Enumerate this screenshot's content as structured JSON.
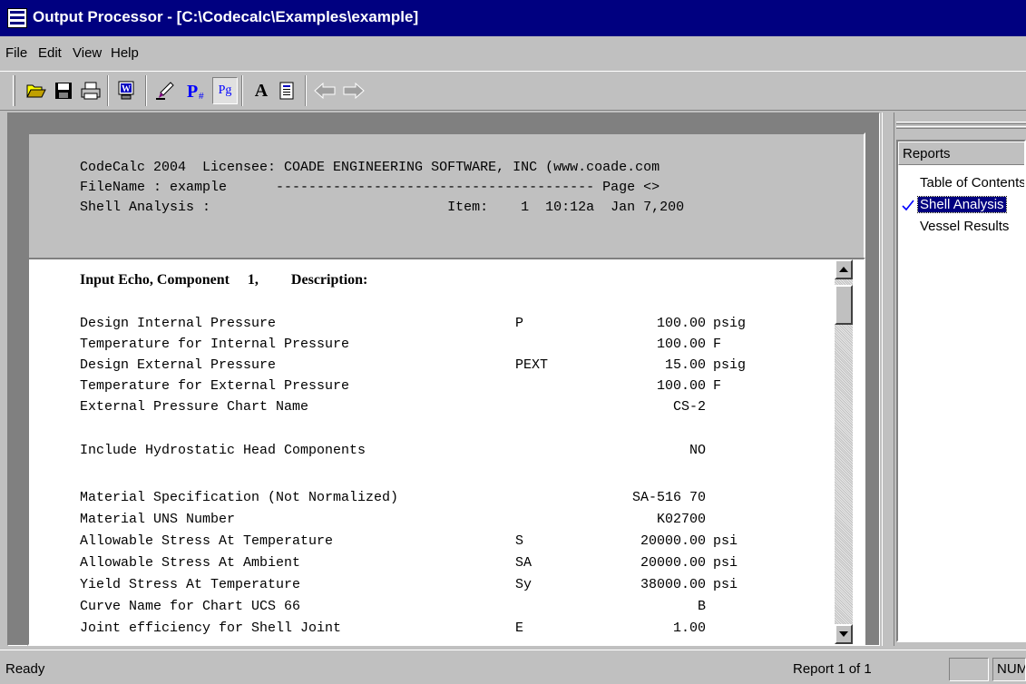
{
  "window": {
    "title": "Output Processor - [C:\\Codecalc\\Examples\\example]"
  },
  "menu": {
    "items": [
      "File",
      "Edit",
      "View",
      "Help"
    ]
  },
  "toolbar": {
    "buttons": [
      "open-icon",
      "save-icon",
      "print-icon",
      "word-export-icon",
      "highlighter-icon",
      "page-number-icon",
      "page-icon",
      "font-icon",
      "document-icon",
      "back-arrow-icon",
      "forward-arrow-icon"
    ],
    "pg_label": "Pg",
    "font_label": "A"
  },
  "report_header": {
    "lines": [
      "CodeCalc 2004  Licensee: COADE ENGINEERING SOFTWARE, INC (www.coade.com",
      "FileName : example      --------------------------------------- Page <>",
      "Shell Analysis :                             Item:    1  10:12a  Jan 7,200"
    ]
  },
  "report": {
    "echo_heading": "Input Echo, Component     1,         Description:",
    "rows": [
      {
        "label": "Design Internal Pressure",
        "sym": "P",
        "value": "100.00",
        "unit": "psig"
      },
      {
        "label": "Temperature for Internal Pressure",
        "sym": "",
        "value": "100.00",
        "unit": "F"
      },
      {
        "label": "Design External Pressure",
        "sym": "PEXT",
        "value": "15.00",
        "unit": "psig"
      },
      {
        "label": "Temperature for External Pressure",
        "sym": "",
        "value": "100.00",
        "unit": "F"
      },
      {
        "label": "External Pressure Chart Name",
        "sym": "",
        "value": "CS-2",
        "unit": ""
      },
      {
        "label": "Include Hydrostatic Head Components",
        "sym": "",
        "value": "NO",
        "unit": ""
      },
      {
        "label": "Material Specification (Not Normalized)",
        "sym": "",
        "value": "SA-516 70",
        "unit": ""
      },
      {
        "label": "Material UNS Number",
        "sym": "",
        "value": "K02700",
        "unit": ""
      },
      {
        "label": "Allowable Stress At Temperature",
        "sym": "S",
        "value": "20000.00",
        "unit": "psi"
      },
      {
        "label": "Allowable Stress At Ambient",
        "sym": "SA",
        "value": "20000.00",
        "unit": "psi"
      },
      {
        "label": "Yield Stress At Temperature",
        "sym": "Sy",
        "value": "38000.00",
        "unit": "psi"
      },
      {
        "label": "Curve Name for Chart UCS 66",
        "sym": "",
        "value": "B",
        "unit": ""
      },
      {
        "label": "Joint efficiency for Shell Joint",
        "sym": "E",
        "value": "1.00",
        "unit": ""
      }
    ]
  },
  "side_pane": {
    "header": "Reports",
    "items": [
      {
        "label": "Table of Contents",
        "selected": false
      },
      {
        "label": "Shell Analysis",
        "selected": true
      },
      {
        "label": "Vessel Results",
        "selected": false
      }
    ]
  },
  "status": {
    "text": "Ready",
    "report": "Report 1 of 1",
    "indicator": "NUM"
  }
}
